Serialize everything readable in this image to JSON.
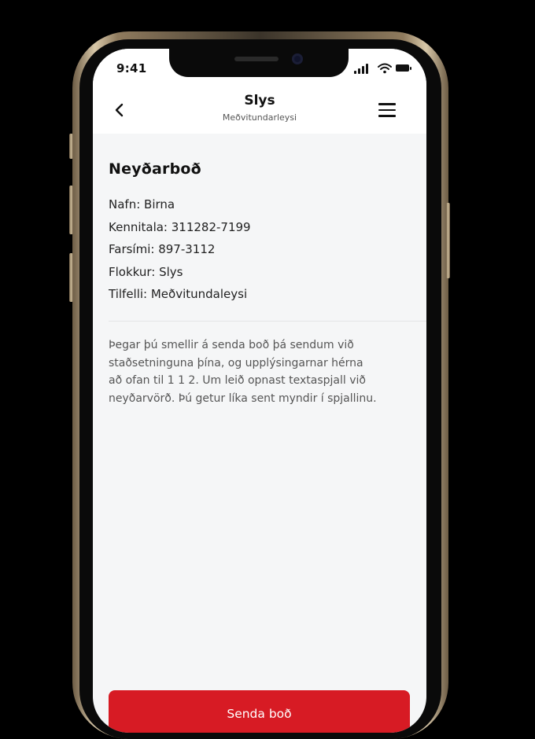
{
  "status_bar": {
    "time": "9:41"
  },
  "nav": {
    "title": "Slys",
    "subtitle": "Meðvitundarleysi",
    "back_icon": "chevron-left-icon",
    "menu_icon": "hamburger-menu-icon"
  },
  "emergency": {
    "heading": "Neyðarboð",
    "details": [
      "Nafn: Birna",
      "Kennitala: 311282-7199",
      "Farsími: 897-3112",
      "Flokkur: Slys",
      "Tilfelli: Meðvitundaleysi"
    ],
    "notice_lines": [
      "Þegar þú smellir á senda boð þá sendum við",
      "staðsetninguna þína, og upplýsingarnar hérna",
      "að ofan til 1 1 2. Um leið opnast textaspjall við",
      "neyðarvörð. Þú getur líka sent myndir í spjallinu."
    ]
  },
  "action": {
    "send_label": "Senda boð"
  },
  "colors": {
    "accent_red": "#d71b24",
    "background": "#f5f6f7",
    "header": "#ffffff",
    "text": "#111111",
    "muted_text": "#555555",
    "divider": "#e4e5e7"
  }
}
